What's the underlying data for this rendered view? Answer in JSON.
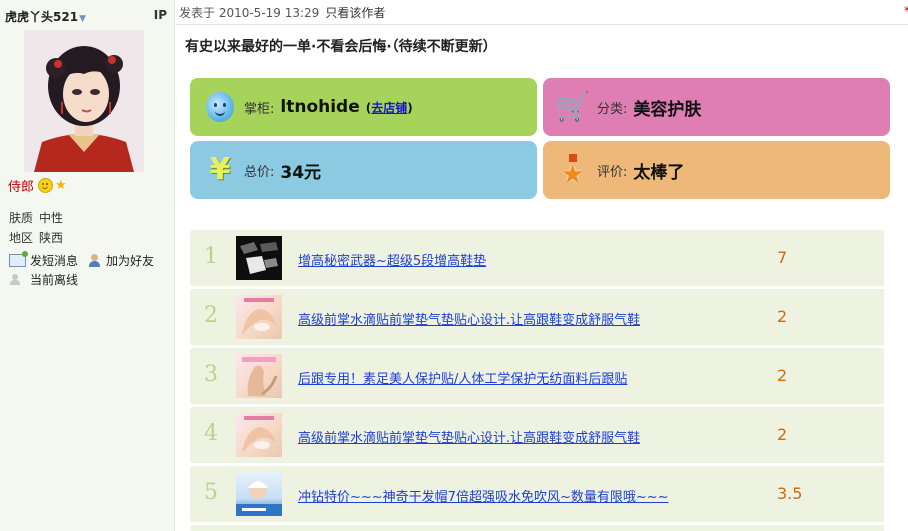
{
  "user": {
    "name": "虎虎丫头521",
    "ip_label": "IP",
    "rank": "侍郎",
    "skin_label": "肤质",
    "skin_value": "中性",
    "region_label": "地区",
    "region_value": "陕西",
    "send_message": "发短消息",
    "add_friend": "加为好友",
    "status": "当前离线"
  },
  "post": {
    "meta": "发表于 2010-5-19 13:29",
    "only_author": "只看该作者",
    "edge_mark": "*",
    "title": "有史以来最好的一单·不看会后悔·（待续不断更新）"
  },
  "cards": {
    "seller_label": "掌柜:",
    "seller_value": "ltnohide",
    "store_open": "(",
    "store_link": "去店铺",
    "store_close": ")",
    "category_label": "分类:",
    "category_value": "美容护肤",
    "price_label": "总价:",
    "price_value": "34元",
    "rating_label": "评价:",
    "rating_value": "太棒了",
    "icons": [
      "drop-mascot-icon",
      "shopping-cart-icon",
      "yen-icon",
      "medal-icon"
    ]
  },
  "items": [
    {
      "index": "1",
      "name": "增高秘密武器~超级5段增高鞋垫",
      "score": "7"
    },
    {
      "index": "2",
      "name": "高级前掌水滴贴前掌垫气垫贴心设计.让高跟鞋变成舒服气鞋",
      "score": "2"
    },
    {
      "index": "3",
      "name": "后跟专用！素足美人保护贴/人体工学保护无纺面料后跟贴",
      "score": "2"
    },
    {
      "index": "4",
      "name": "高级前掌水滴贴前掌垫气垫贴心设计.让高跟鞋变成舒服气鞋",
      "score": "2"
    },
    {
      "index": "5",
      "name": "冲钻特价~~~神奇干发帽7倍超强吸水免吹风~数量有限哦~~~",
      "score": "3.5"
    }
  ],
  "colors": {
    "seller_card": "#a6d35a",
    "category_card": "#de7eb3",
    "price_card": "#8bcae0",
    "rating_card": "#edb878",
    "row_bg": "#eef2e1",
    "link": "#1d3fd4",
    "score": "#d06a10",
    "rank": "#c00000"
  }
}
